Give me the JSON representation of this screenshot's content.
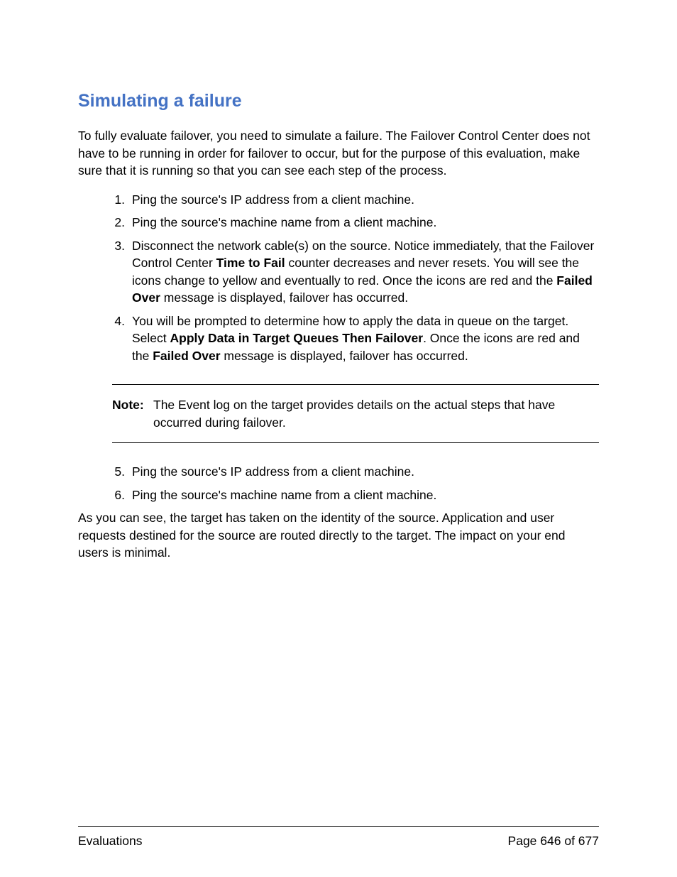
{
  "heading": "Simulating a failure",
  "intro": "To fully evaluate failover, you need to simulate a failure. The Failover Control Center does not have to be running in order for failover to occur, but for the purpose of this evaluation, make sure that it is running so that you can see each step of the process.",
  "item1": {
    "num": "1.",
    "text": "Ping the source's IP address from a client machine."
  },
  "item2": {
    "num": "2.",
    "text": "Ping the source's machine name from a client machine."
  },
  "item3": {
    "num": "3.",
    "seg1": "Disconnect the network cable(s) on the source. Notice immediately, that the Failover Control Center ",
    "bold1": "Time to Fail",
    "seg2": " counter decreases and never resets. You will see the icons change to yellow and eventually to red. Once the icons are red and the ",
    "bold2": "Failed Over",
    "seg3": " message is displayed, failover has occurred."
  },
  "item4": {
    "num": "4.",
    "seg1": "You will be prompted to determine how to apply the data in queue on the target. Select ",
    "bold1": "Apply Data in Target Queues Then Failover",
    "seg2": ". Once the icons are red and the ",
    "bold2": "Failed Over",
    "seg3": " message is displayed, failover has occurred."
  },
  "note": {
    "label": "Note:",
    "text": "The Event log on the target provides details on the actual steps that have occurred during failover."
  },
  "item5": {
    "num": "5.",
    "text": "Ping the source's IP address from a client machine."
  },
  "item6": {
    "num": "6.",
    "text": "Ping the source's machine name from a client machine."
  },
  "outro": "As you can see, the target has taken on the identity of the source. Application and user requests destined for the source are routed directly to the target. The impact on your end users is minimal.",
  "footer": {
    "left": "Evaluations",
    "right": "Page 646 of 677"
  }
}
